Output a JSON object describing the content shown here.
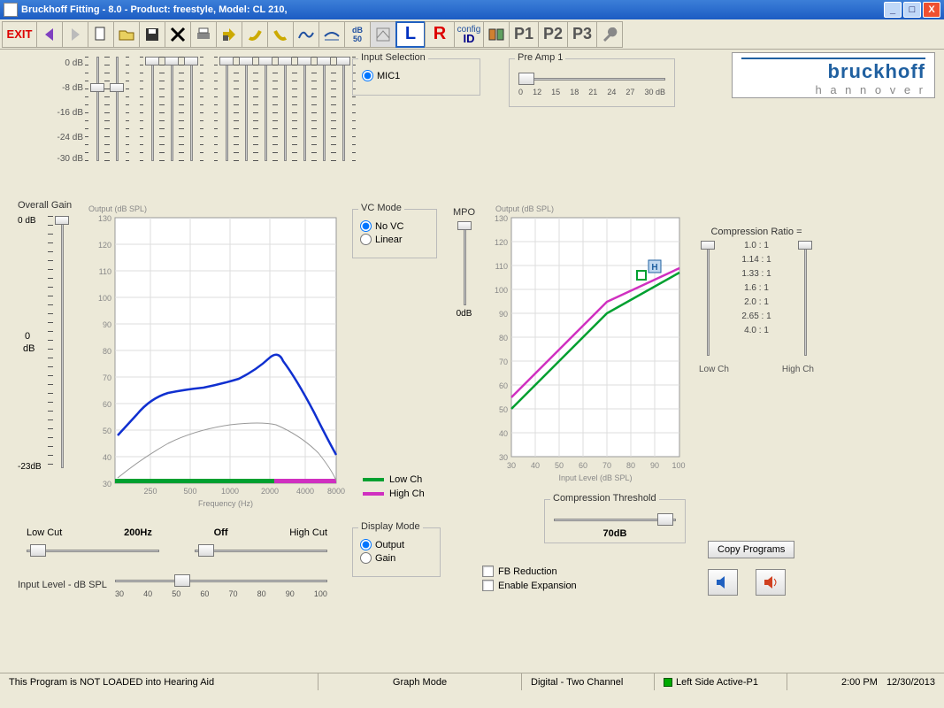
{
  "title": "Bruckhoff Fitting - 8.0 - Product: freestyle,  Model: CL 210,",
  "toolbar": {
    "exit": "EXIT",
    "l": "L",
    "r": "R",
    "config_top": "config",
    "config_bot": "ID",
    "p1": "P1",
    "p2": "P2",
    "p3": "P3"
  },
  "logo": {
    "line1": "bruckhoff",
    "line2": "h a n n o v e r"
  },
  "input_selection": {
    "legend": "Input Selection",
    "option": "MIC1"
  },
  "preamp": {
    "legend": "Pre Amp 1",
    "ticks": [
      "0",
      "12",
      "15",
      "18",
      "21",
      "24",
      "27",
      "30 dB"
    ]
  },
  "eq_labels": [
    "0 dB",
    "-8 dB",
    "-16 dB",
    "-24 dB",
    "-30 dB"
  ],
  "overall_gain": {
    "label": "Overall Gain",
    "top": "0 dB",
    "mid": "0",
    "unit": "dB",
    "bot": "-23dB"
  },
  "vc_mode": {
    "legend": "VC Mode",
    "opt1": "No VC",
    "opt2": "Linear"
  },
  "mpo": {
    "label": "MPO",
    "bot": "0dB"
  },
  "display_mode": {
    "legend": "Display Mode",
    "opt1": "Output",
    "opt2": "Gain"
  },
  "low_high_cut": {
    "low": "Low Cut",
    "val": "200Hz",
    "off": "Off",
    "high": "High Cut"
  },
  "input_level": {
    "label": "Input Level - dB SPL",
    "ticks": [
      "30",
      "40",
      "50",
      "60",
      "70",
      "80",
      "90",
      "100"
    ]
  },
  "legend_left": {
    "low": "Low Ch",
    "high": "High Ch"
  },
  "comp_ratio": {
    "label": "Compression Ratio =",
    "values": [
      "1.0 : 1",
      "1.14 : 1",
      "1.33 : 1",
      "1.6 : 1",
      "2.0 : 1",
      "2.65 : 1",
      "4.0 : 1"
    ],
    "low": "Low Ch",
    "high": "High Ch"
  },
  "comp_threshold": {
    "legend": "Compression Threshold",
    "value": "70dB"
  },
  "checkboxes": {
    "fb": "FB Reduction",
    "exp": "Enable Expansion"
  },
  "copy_btn": "Copy Programs",
  "status": {
    "s1": "This Program is NOT LOADED into Hearing Aid",
    "s2": "Graph Mode",
    "s3": "Digital - Two Channel",
    "s4": "Left Side Active-P1",
    "s5": "2:00 PM",
    "s6": "12/30/2013"
  },
  "chart_data": [
    {
      "type": "line",
      "title": "Output (dB SPL)",
      "xlabel": "Frequency (Hz)",
      "x_log": true,
      "x_ticks": [
        250,
        500,
        1000,
        2000,
        4000,
        8000
      ],
      "ylim": [
        30,
        130
      ],
      "series": [
        {
          "name": "Output (blue)",
          "color": "#1030d0",
          "x": [
            160,
            250,
            400,
            500,
            700,
            1000,
            1500,
            2000,
            2500,
            3000,
            4000,
            6000,
            8000
          ],
          "y": [
            48,
            58,
            64,
            65,
            66,
            67,
            69,
            73,
            77,
            74,
            69,
            56,
            44
          ]
        },
        {
          "name": "faint",
          "color": "#999",
          "x": [
            160,
            250,
            500,
            1000,
            2000,
            3000,
            4000,
            6000,
            8000
          ],
          "y": [
            32,
            38,
            45,
            48,
            50,
            49,
            46,
            40,
            31
          ]
        }
      ],
      "bands": {
        "green_end": 3000,
        "magenta_start": 3000
      }
    },
    {
      "type": "line",
      "title": "Output (dB SPL)",
      "xlabel": "Input Level (dB SPL)",
      "xlim": [
        30,
        100
      ],
      "ylim": [
        30,
        130
      ],
      "series": [
        {
          "name": "Low Ch",
          "color": "#00a030",
          "x": [
            30,
            70,
            100
          ],
          "y": [
            50,
            90,
            107
          ]
        },
        {
          "name": "High Ch",
          "color": "#d030c0",
          "x": [
            30,
            70,
            100
          ],
          "y": [
            55,
            95,
            109
          ]
        }
      ],
      "marker": {
        "x": 90,
        "y": 108,
        "label": "H"
      }
    }
  ]
}
